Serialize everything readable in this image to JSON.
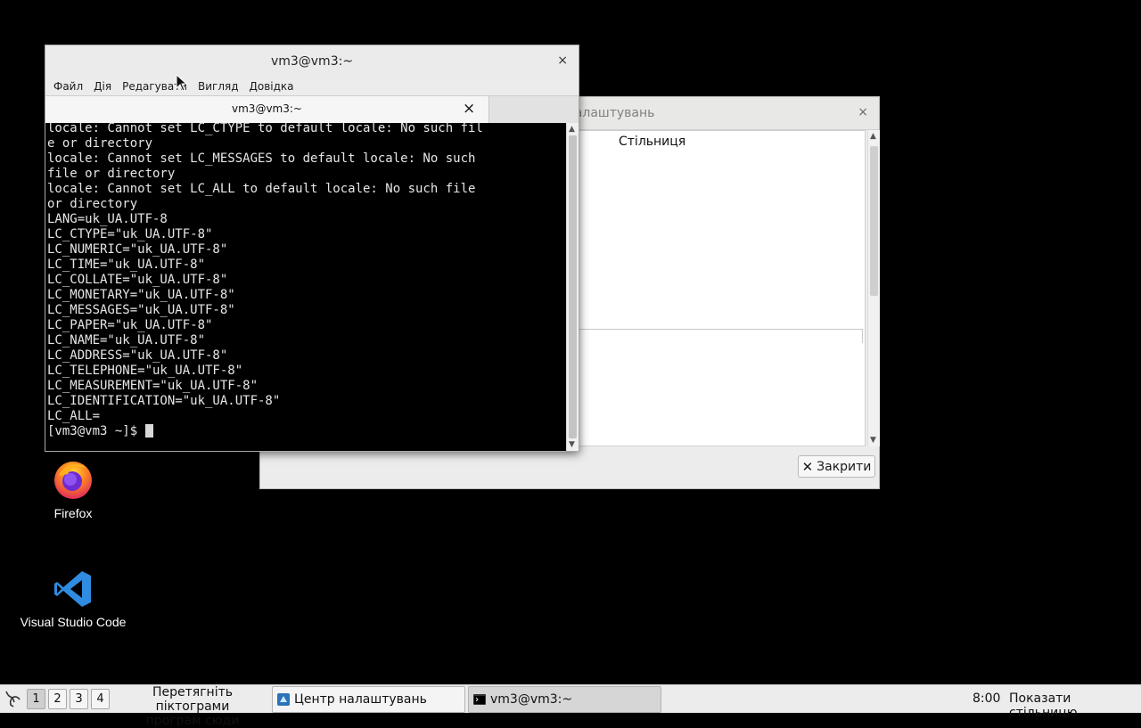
{
  "settings_window": {
    "title": "шалаштувань",
    "close_symbol": "×",
    "desktop_item": "Стільниця",
    "close_button_label": "Закрити"
  },
  "terminal": {
    "title": "vm3@vm3:~",
    "close_symbol": "×",
    "menu": [
      "Файл",
      "Дія",
      "Редагувати",
      "Вигляд",
      "Довідка"
    ],
    "tab_label": "vm3@vm3:~",
    "tab_close_symbol": "×",
    "output": "locale: Cannot set LC_CTYPE to default locale: No such fil\ne or directory\nlocale: Cannot set LC_MESSAGES to default locale: No such\nfile or directory\nlocale: Cannot set LC_ALL to default locale: No such file\nor directory\nLANG=uk_UA.UTF-8\nLC_CTYPE=\"uk_UA.UTF-8\"\nLC_NUMERIC=\"uk_UA.UTF-8\"\nLC_TIME=\"uk_UA.UTF-8\"\nLC_COLLATE=\"uk_UA.UTF-8\"\nLC_MONETARY=\"uk_UA.UTF-8\"\nLC_MESSAGES=\"uk_UA.UTF-8\"\nLC_PAPER=\"uk_UA.UTF-8\"\nLC_NAME=\"uk_UA.UTF-8\"\nLC_ADDRESS=\"uk_UA.UTF-8\"\nLC_TELEPHONE=\"uk_UA.UTF-8\"\nLC_MEASUREMENT=\"uk_UA.UTF-8\"\nLC_IDENTIFICATION=\"uk_UA.UTF-8\"\nLC_ALL=",
    "prompt": "[vm3@vm3 ~]$ "
  },
  "desktop_icons": {
    "firefox": "Firefox",
    "vscode": "Visual Studio Code"
  },
  "taskbar": {
    "workspaces": [
      "1",
      "2",
      "3",
      "4"
    ],
    "active_workspace": "1",
    "hint_line1": "Перетягніть піктограми",
    "hint_line2": "програм сюди",
    "task_settings": "Центр налаштувань",
    "task_terminal": "vm3@vm3:~",
    "clock": "8:00",
    "show_desktop": "Показати стільницю"
  },
  "colors": {
    "desktop_background": "#000000",
    "panel": "#ececec",
    "terminal_background": "#000000",
    "terminal_text": "#e6e6e6",
    "vscode_blue": "#2f8ce0"
  }
}
